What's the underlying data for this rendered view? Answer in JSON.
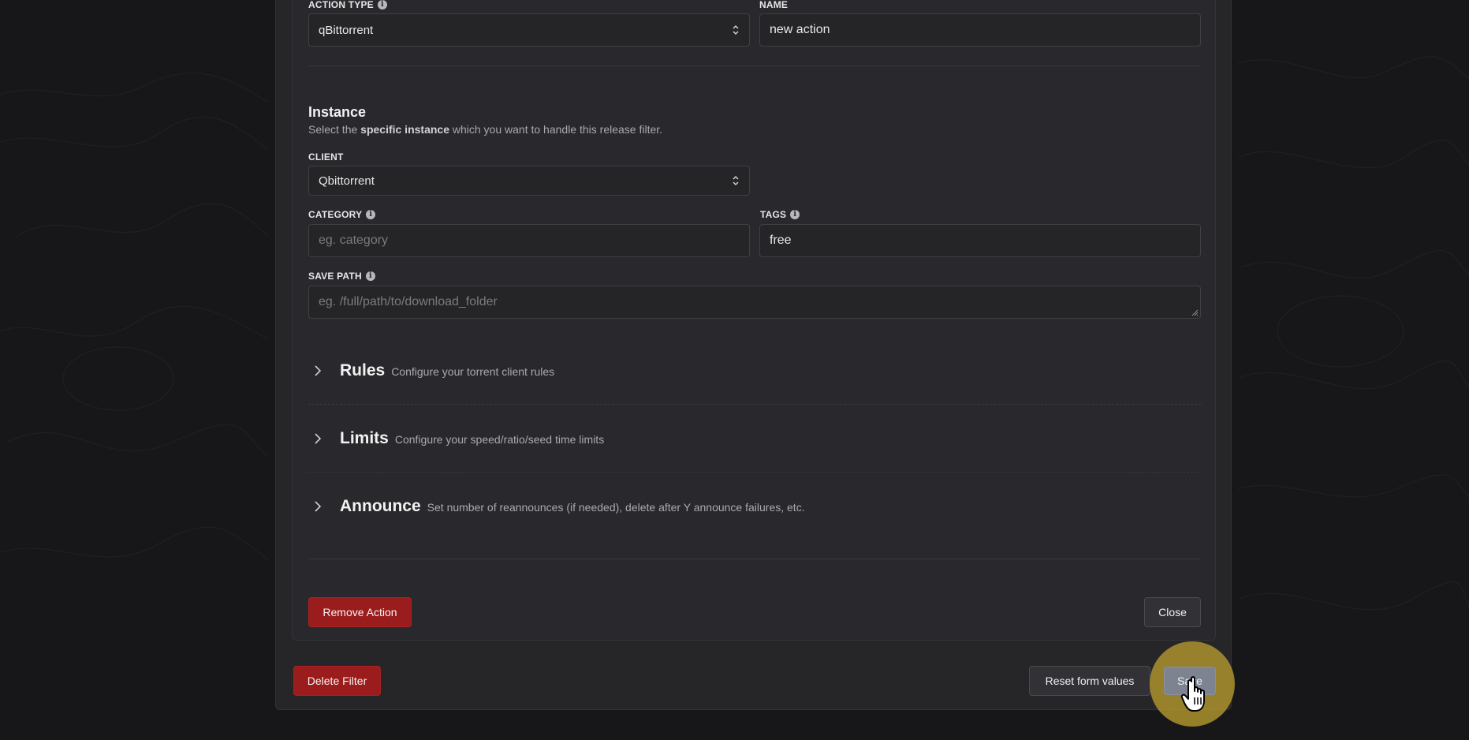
{
  "action_type": {
    "label": "ACTION TYPE",
    "value": "qBittorrent"
  },
  "name": {
    "label": "NAME",
    "value": "new action"
  },
  "instance": {
    "title": "Instance",
    "desc_prefix": "Select the ",
    "desc_bold": "specific instance",
    "desc_suffix": " which you want to handle this release filter."
  },
  "client": {
    "label": "CLIENT",
    "value": "Qbittorrent"
  },
  "category": {
    "label": "CATEGORY",
    "placeholder": "eg. category",
    "value": ""
  },
  "tags": {
    "label": "TAGS",
    "value": "free"
  },
  "save_path": {
    "label": "SAVE PATH",
    "placeholder": "eg. /full/path/to/download_folder"
  },
  "sections": [
    {
      "title": "Rules",
      "desc": "Configure your torrent client rules"
    },
    {
      "title": "Limits",
      "desc": "Configure your speed/ratio/seed time limits"
    },
    {
      "title": "Announce",
      "desc": "Set number of reannounces (if needed), delete after Y announce failures, etc."
    }
  ],
  "buttons": {
    "remove_action": "Remove Action",
    "close": "Close",
    "delete_filter": "Delete Filter",
    "reset": "Reset form values",
    "save": "Save"
  },
  "colors": {
    "danger": "#9b1c1c",
    "highlight": "#b1962d",
    "background": "#17171a",
    "panel": "#262629"
  },
  "icons": {
    "info": "info-icon",
    "select_arrow": "select-arrows-icon",
    "chevron": "chevron-right-icon",
    "cursor": "hand-pointer-cursor-icon"
  }
}
